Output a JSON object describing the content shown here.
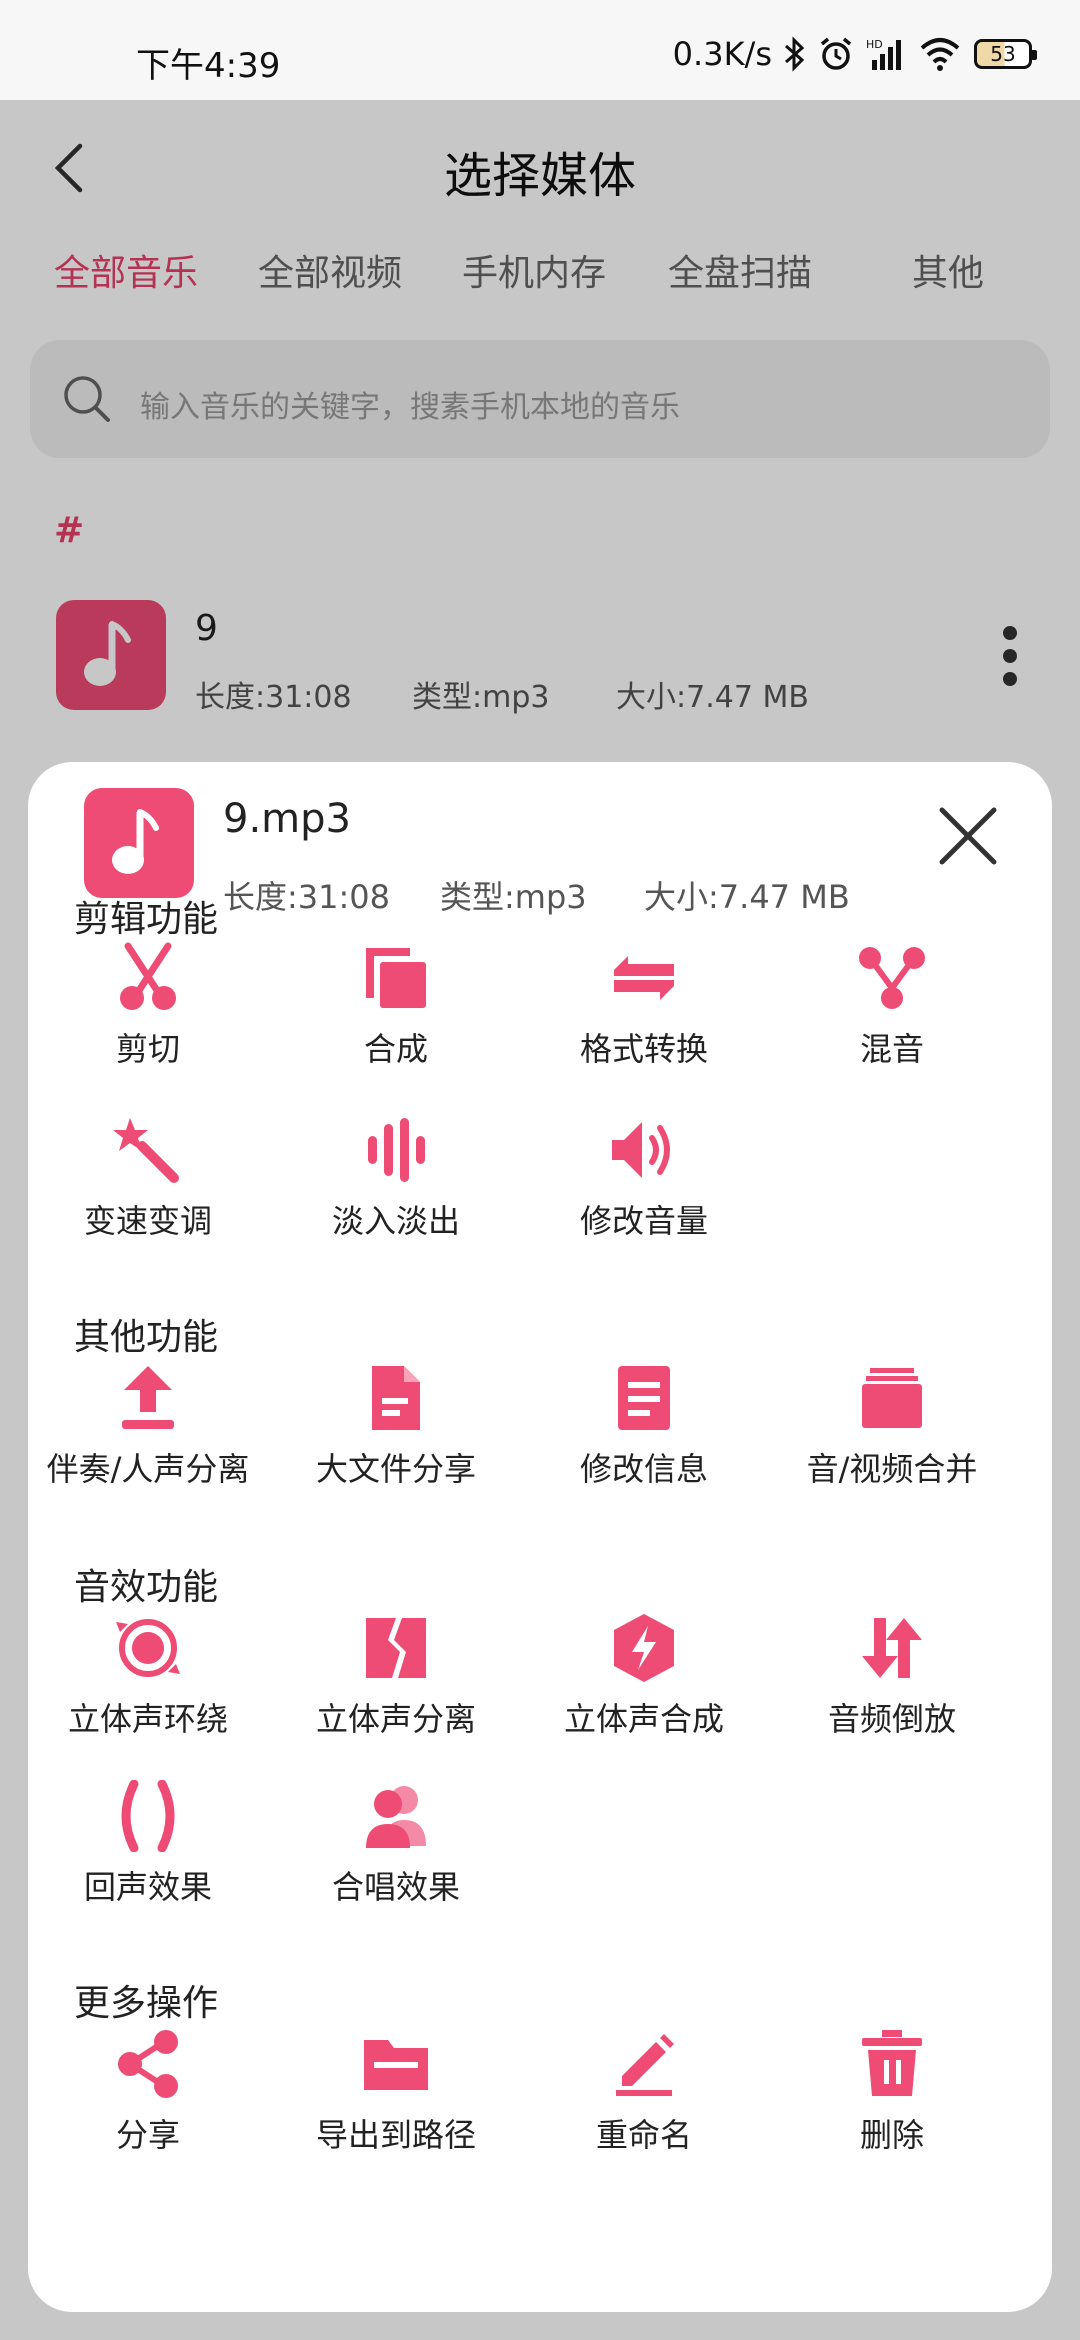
{
  "colors": {
    "accent": "#e8416a",
    "icon": "#ee4b75"
  },
  "status_bar": {
    "time": "下午4:39",
    "speed": "0.3K/s",
    "battery": "53"
  },
  "header": {
    "title": "选择媒体"
  },
  "tabs": [
    {
      "label": "全部音乐",
      "active": true
    },
    {
      "label": "全部视频",
      "active": false
    },
    {
      "label": "手机内存",
      "active": false
    },
    {
      "label": "全盘扫描",
      "active": false
    },
    {
      "label": "其他",
      "active": false
    }
  ],
  "search": {
    "placeholder": "输入音乐的关键字，搜素手机本地的音乐"
  },
  "list": {
    "section_letter": "#",
    "item": {
      "name": "9",
      "duration": "长度:31:08",
      "type": "类型:mp3",
      "size": "大小:7.47 MB"
    }
  },
  "sheet": {
    "filename": "9.mp3",
    "duration": "长度:31:08",
    "type": "类型:mp3",
    "size": "大小:7.47 MB",
    "groups": [
      {
        "title": "剪辑功能",
        "items": [
          {
            "label": "剪切",
            "icon": "scissors-icon"
          },
          {
            "label": "合成",
            "icon": "merge-icon"
          },
          {
            "label": "格式转换",
            "icon": "convert-icon"
          },
          {
            "label": "混音",
            "icon": "mix-icon"
          },
          {
            "label": "变速变调",
            "icon": "magic-wand-icon"
          },
          {
            "label": "淡入淡出",
            "icon": "waveform-icon"
          },
          {
            "label": "修改音量",
            "icon": "volume-icon"
          }
        ]
      },
      {
        "title": "其他功能",
        "items": [
          {
            "label": "伴奏/人声分离",
            "icon": "upload-icon"
          },
          {
            "label": "大文件分享",
            "icon": "file-icon"
          },
          {
            "label": "修改信息",
            "icon": "document-icon"
          },
          {
            "label": "音/视频合并",
            "icon": "stack-icon"
          }
        ]
      },
      {
        "title": "音效功能",
        "items": [
          {
            "label": "立体声环绕",
            "icon": "surround-icon"
          },
          {
            "label": "立体声分离",
            "icon": "split-icon"
          },
          {
            "label": "立体声合成",
            "icon": "bolt-hexagon-icon"
          },
          {
            "label": "音频倒放",
            "icon": "reverse-arrows-icon"
          },
          {
            "label": "回声效果",
            "icon": "parentheses-icon"
          },
          {
            "label": "合唱效果",
            "icon": "users-icon"
          }
        ]
      },
      {
        "title": "更多操作",
        "items": [
          {
            "label": "分享",
            "icon": "share-icon"
          },
          {
            "label": "导出到路径",
            "icon": "folder-icon"
          },
          {
            "label": "重命名",
            "icon": "edit-icon"
          },
          {
            "label": "删除",
            "icon": "trash-icon"
          }
        ]
      }
    ]
  }
}
